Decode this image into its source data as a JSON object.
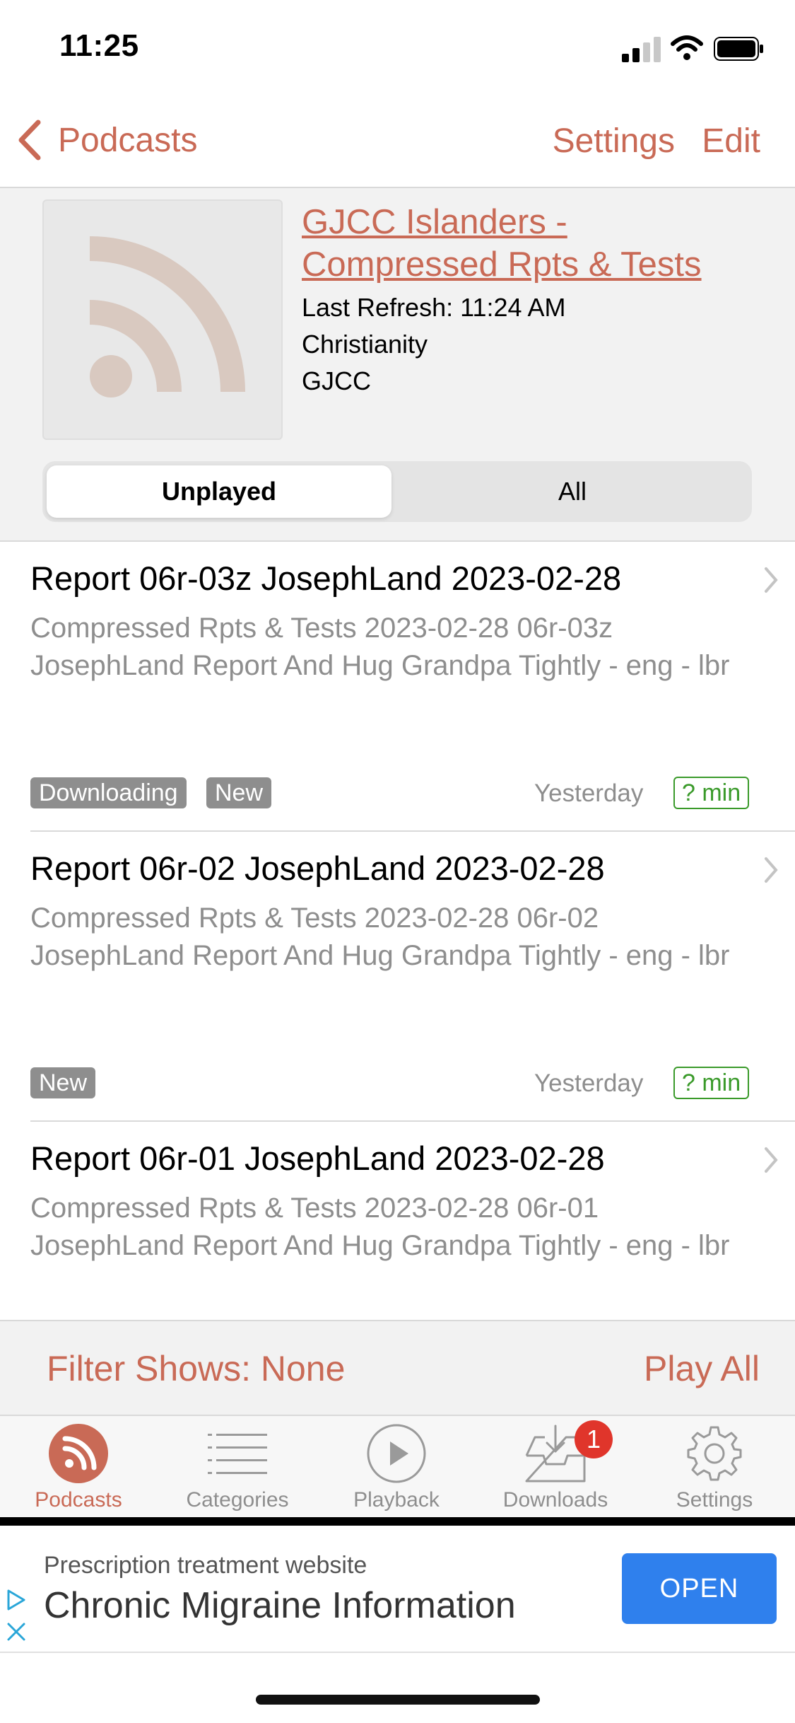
{
  "status_bar": {
    "time": "11:25"
  },
  "nav": {
    "back_label": "Podcasts",
    "settings_label": "Settings",
    "edit_label": "Edit"
  },
  "podcast": {
    "title": "GJCC Islanders - Compressed Rpts & Tests",
    "last_refresh": "Last Refresh: 11:24 AM",
    "category": "Christianity",
    "author": "GJCC"
  },
  "segment": {
    "unplayed": "Unplayed",
    "all": "All"
  },
  "episodes": [
    {
      "title": "Report 06r-03z JosephLand 2023-02-28",
      "description": "Compressed Rpts & Tests 2023-02-28 06r-03z JosephLand Report And Hug Grandpa Tightly - eng - lbr",
      "badges": [
        "Downloading",
        "New"
      ],
      "date": "Yesterday",
      "duration": "? min"
    },
    {
      "title": "Report 06r-02 JosephLand 2023-02-28",
      "description": "Compressed Rpts & Tests 2023-02-28 06r-02 JosephLand Report And Hug Grandpa Tightly - eng - lbr",
      "badges": [
        "New"
      ],
      "date": "Yesterday",
      "duration": "? min"
    },
    {
      "title": "Report 06r-01 JosephLand 2023-02-28",
      "description": "Compressed Rpts & Tests 2023-02-28 06r-01 JosephLand Report And Hug Grandpa Tightly - eng - lbr"
    }
  ],
  "filter_bar": {
    "filter_label": "Filter Shows: None",
    "play_all_label": "Play All"
  },
  "tabs": [
    {
      "label": "Podcasts",
      "icon": "podcast-icon",
      "active": true
    },
    {
      "label": "Categories",
      "icon": "list-icon"
    },
    {
      "label": "Playback",
      "icon": "play-circle-icon"
    },
    {
      "label": "Downloads",
      "icon": "inbox-download-icon",
      "badge": "1"
    },
    {
      "label": "Settings",
      "icon": "gear-icon"
    }
  ],
  "ad": {
    "small_text": "Prescription treatment website",
    "headline": "Chronic Migraine Information",
    "button_label": "OPEN"
  },
  "colors": {
    "accent": "#c96a56",
    "duration_green": "#3a9a2a",
    "badge_gray": "#8e8e8e",
    "ad_button": "#2f80ed"
  }
}
